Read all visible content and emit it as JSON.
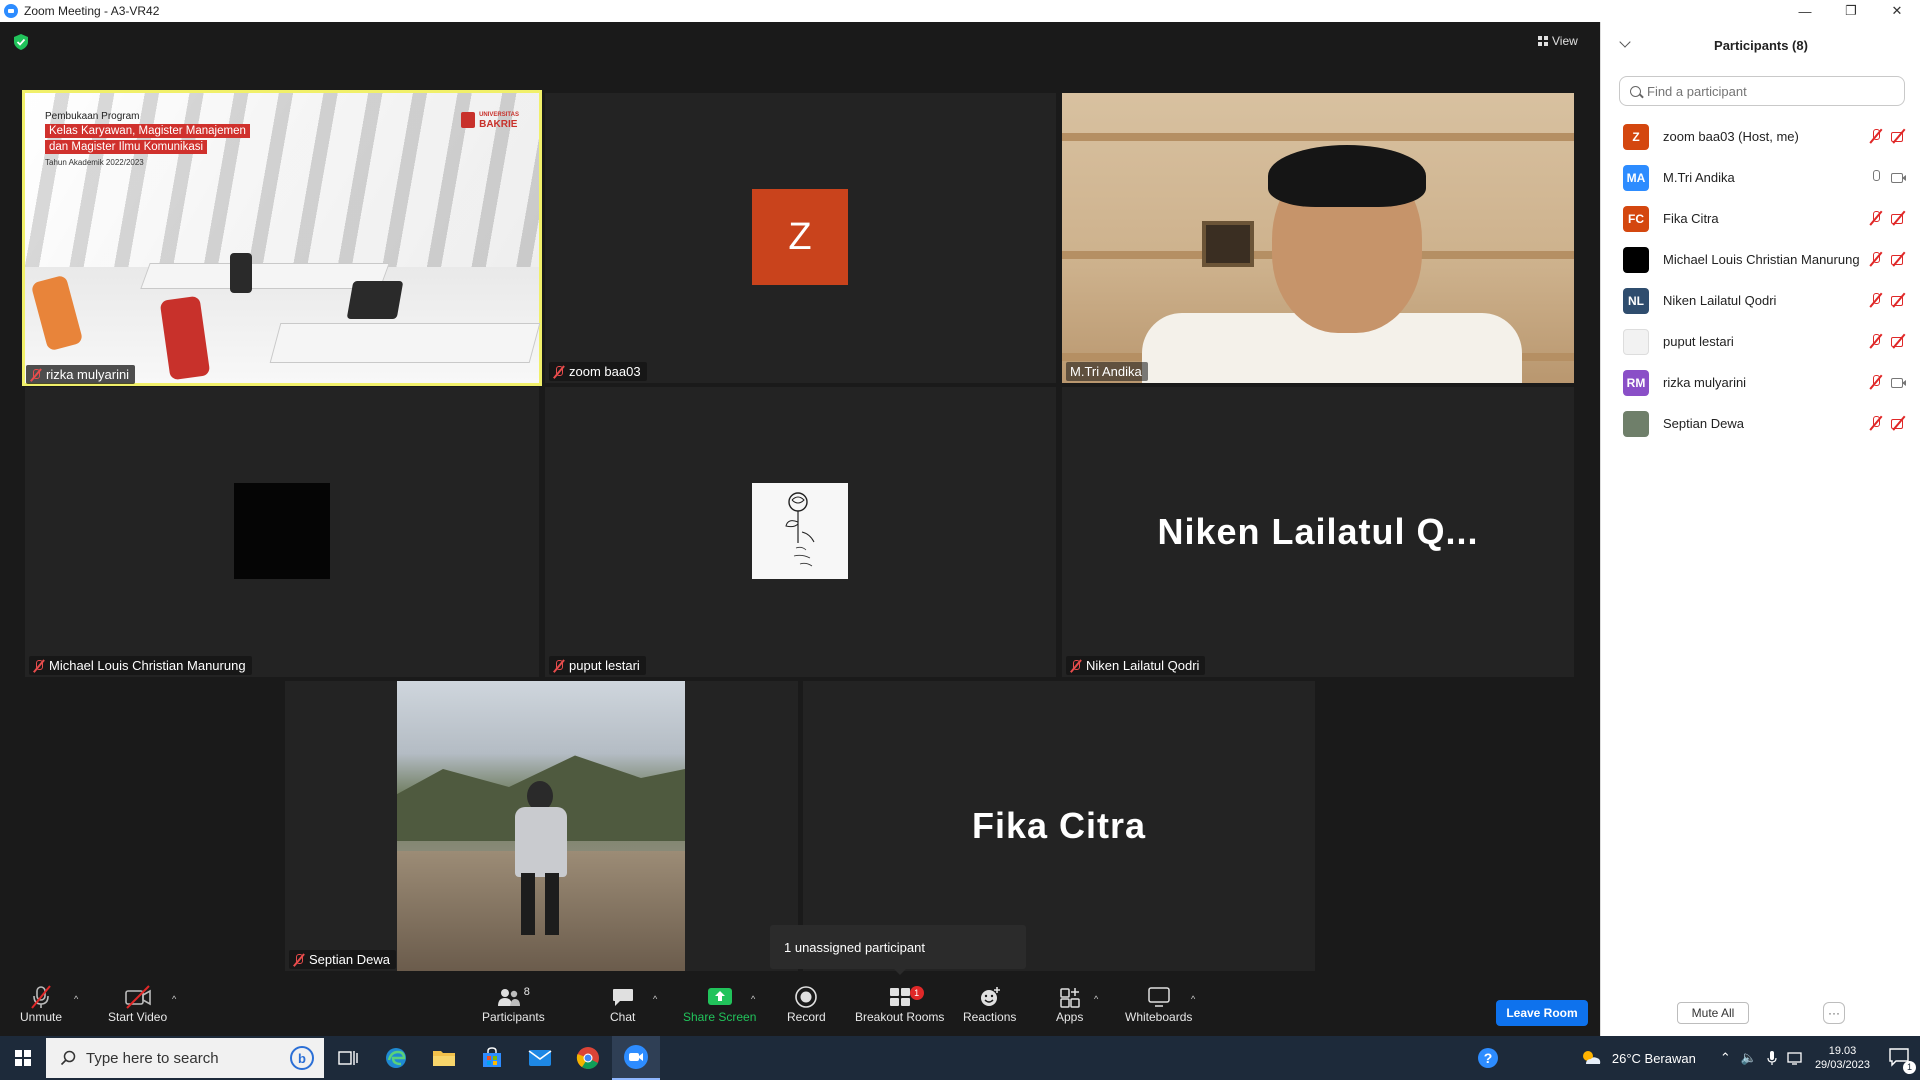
{
  "window": {
    "title": "Zoom Meeting - A3-VR42",
    "minimize": "—",
    "restore": "❐",
    "close": "✕"
  },
  "view_label": "View",
  "tiles": {
    "rizka": "rizka mulyarini",
    "zoom": "zoom baa03",
    "zoom_initial": "Z",
    "mtri": "M.Tri Andika",
    "michael": "Michael Louis Christian Manurung",
    "puput": "puput lestari",
    "niken": "Niken Lailatul Qodri",
    "niken_big": "Niken  Lailatul  Q...",
    "septian": "Septian Dewa",
    "fika_big": "Fika Citra"
  },
  "slide": {
    "line1": "Pembukaan Program",
    "line2": "Kelas Karyawan, Magister Manajemen",
    "line3": "dan Magister Ilmu Komunikasi",
    "line4": "Tahun Akademik 2022/2023",
    "logo_top": "UNIVERSITAS",
    "logo": "BAKRIE"
  },
  "tooltip": "1 unassigned participant",
  "toolbar": {
    "unmute": "Unmute",
    "start_video": "Start Video",
    "participants": "Participants",
    "participants_count": "8",
    "chat": "Chat",
    "share_screen": "Share Screen",
    "record": "Record",
    "breakout": "Breakout Rooms",
    "breakout_badge": "1",
    "reactions": "Reactions",
    "apps": "Apps",
    "whiteboards": "Whiteboards",
    "leave_room": "Leave Room"
  },
  "panel": {
    "title": "Participants (8)",
    "search_placeholder": "Find a participant",
    "mute_all": "Mute All",
    "more": "···",
    "participants": [
      {
        "initials": "Z",
        "name": "zoom baa03 (Host, me)",
        "color": "#d4470f",
        "mic": "off",
        "cam": "off"
      },
      {
        "initials": "MA",
        "name": "M.Tri Andika",
        "color": "#2d8cff",
        "mic": "on",
        "cam": "on"
      },
      {
        "initials": "FC",
        "name": "Fika Citra",
        "color": "#d4470f",
        "mic": "off",
        "cam": "off"
      },
      {
        "initials": "",
        "name": "Michael Louis Christian Manurung",
        "color": "#000000",
        "mic": "off",
        "cam": "off"
      },
      {
        "initials": "NL",
        "name": "Niken Lailatul Qodri",
        "color": "#2f4d6e",
        "mic": "off",
        "cam": "off"
      },
      {
        "initials": "",
        "name": "puput lestari",
        "color": "#f2f2f2",
        "mic": "off",
        "cam": "off"
      },
      {
        "initials": "RM",
        "name": "rizka mulyarini",
        "color": "#8a4fc7",
        "mic": "off",
        "cam": "on"
      },
      {
        "initials": "",
        "name": "Septian Dewa",
        "color": "#6f7f6a",
        "mic": "off",
        "cam": "off"
      }
    ]
  },
  "taskbar": {
    "search_placeholder": "Type here to search",
    "weather": "26°C  Berawan",
    "time": "19.03",
    "date": "29/03/2023",
    "notification_count": "1"
  },
  "colors": {
    "accent": "#0e72ed",
    "active_speaker": "#f1f06a",
    "muted": "#e02828",
    "share_green": "#21c35b"
  }
}
